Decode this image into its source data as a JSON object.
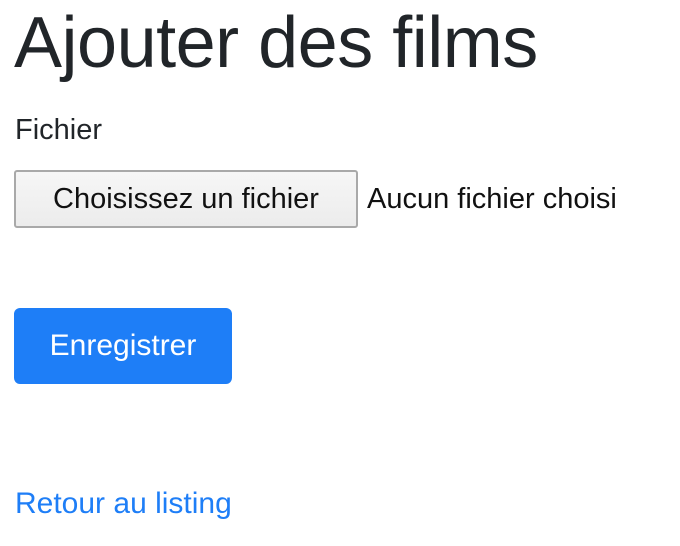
{
  "header": {
    "title": "Ajouter des films"
  },
  "form": {
    "file_label": "Fichier",
    "file_button_label": "Choisissez un fichier",
    "file_status": "Aucun fichier choisi",
    "submit_label": "Enregistrer"
  },
  "footer": {
    "back_link_label": "Retour au listing"
  },
  "colors": {
    "primary": "#1e7ef7",
    "text": "#212529"
  }
}
